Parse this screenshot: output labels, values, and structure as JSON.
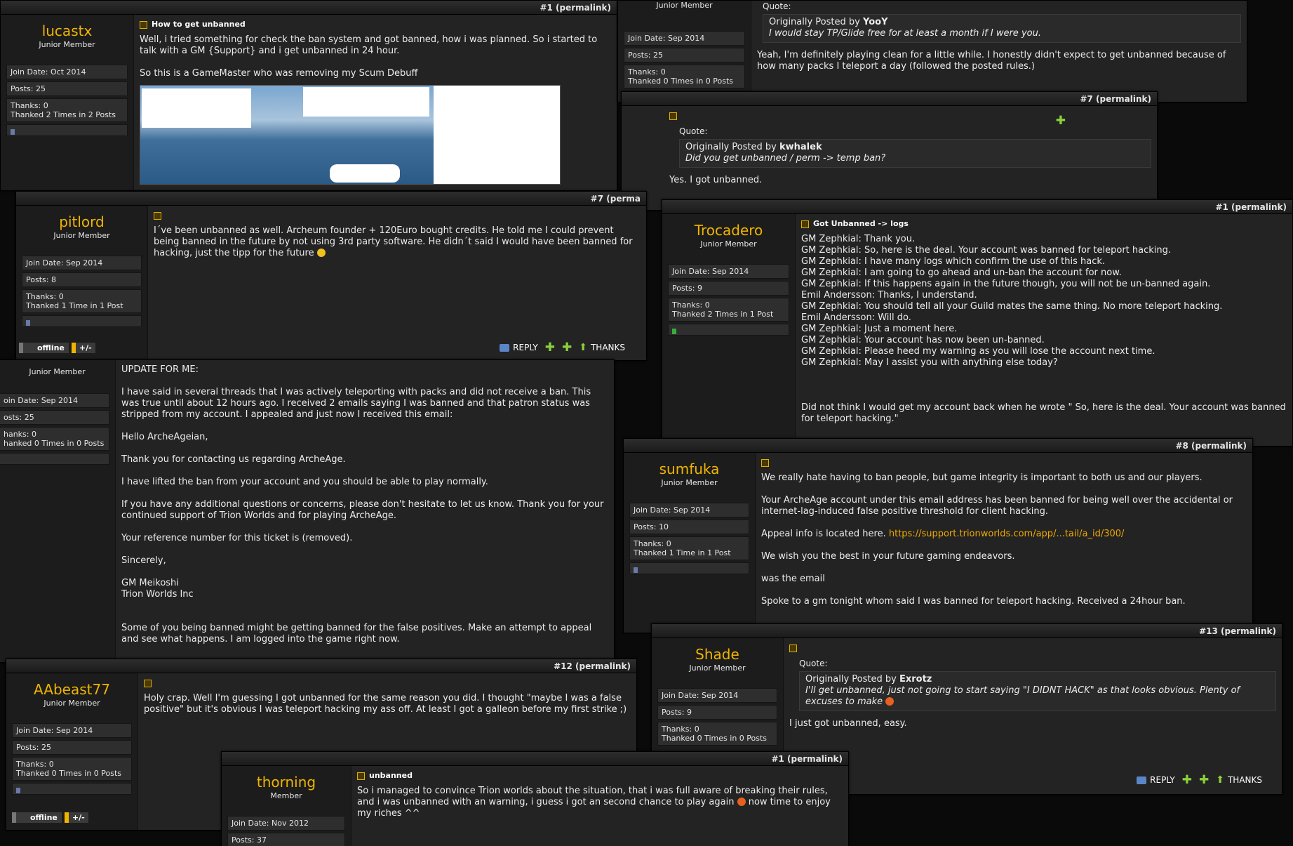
{
  "labels": {
    "join_date_prefix": "Join Date:",
    "posts_prefix": "Posts:",
    "quote": "Quote:",
    "originally_posted_by": "Originally Posted by",
    "reply": "REPLY",
    "thanks": "THANKS",
    "offline": "offline",
    "pm": "+/-"
  },
  "posts": {
    "lucastx": {
      "num": "#1 (permalink)",
      "user": "lucastx",
      "rank": "Junior Member",
      "join": "Join Date: Oct 2014",
      "posts": "Posts: 25",
      "thanks": "Thanks: 0",
      "thanked": "Thanked 2 Times in 2 Posts",
      "title": "How to get unbanned",
      "p1": "Well, i tried something for check the ban system and got banned, how i was planned. So i started to talk with a GM {Support} and i get unbanned in 24 hour.",
      "p2": "So this is a GameMaster who was removing my Scum Debuff"
    },
    "yooy": {
      "rank": "Junior Member",
      "join": "Join Date: Sep 2014",
      "posts": "Posts: 25",
      "thanks": "Thanks: 0",
      "thanked": "Thanked 0 Times in 0 Posts",
      "quote_author": "YooY",
      "quote_text": "I would stay TP/Glide free for at least a month if I were you.",
      "p1": "Yeah, I'm definitely playing clean for a little while. I honestly didn't expect to get unbanned because of how many packs I teleport a day (followed the posted rules.)"
    },
    "kwhalek": {
      "num": "#7 (permalink)",
      "quote_author": "kwhalek",
      "quote_text": "Did you get unbanned / perm -> temp ban?",
      "p1": "Yes. I got unbanned."
    },
    "pitlord": {
      "num": "#7 (perma",
      "user": "pitlord",
      "rank": "Junior Member",
      "join": "Join Date: Sep 2014",
      "posts": "Posts: 8",
      "thanks": "Thanks: 0",
      "thanked": "Thanked 1 Time in 1 Post",
      "p1": "I´ve been unbanned as well. Archeum founder + 120Euro bought credits. He told me I could prevent being banned in the future by not using 3rd party software. He didn´t said I would have been banned for hacking, just the tipp for the future"
    },
    "trocadero": {
      "num": "#1 (permalink)",
      "user": "Trocadero",
      "rank": "Junior Member",
      "join": "Join Date: Sep 2014",
      "posts": "Posts: 9",
      "thanks": "Thanks: 0",
      "thanked": "Thanked 2 Times in 1 Post",
      "title": "Got Unbanned -> logs",
      "log": "GM Zephkial: Thank you.\nGM Zephkial: So, here is the deal. Your account was banned for teleport hacking.\nGM Zephkial: I have many logs which confirm the use of this hack.\nGM Zephkial: I am going to go ahead and un-ban the account for now.\nGM Zephkial: If this happens again in the future though, you will not be un-banned again.\nEmil Andersson: Thanks, I understand.\nGM Zephkial: You should tell all your Guild mates the same thing. No more teleport hacking.\nEmil Andersson: Will do.\nGM Zephkial: Just a moment here.\nGM Zephkial: Your account has now been un-banned.\nGM Zephkial: Please heed my warning as you will lose the account next time.\nGM Zephkial: May I assist you with anything else today?",
      "p2": "Did not think I would get my account back when he wrote \" So, here is the deal. Your account was banned for teleport hacking.\""
    },
    "update": {
      "rank": "Junior Member",
      "join": "oin Date: Sep 2014",
      "posts": "osts: 25",
      "thanks": "hanks: 0",
      "thanked": "hanked 0 Times in 0 Posts",
      "text": "UPDATE FOR ME:\n\nI have said in several threads that I was actively teleporting with packs and did not receive a ban. This was true until about 12 hours ago. I received 2 emails saying I was banned and that patron status was stripped from my account. I appealed and just now I received this email:\n\nHello ArcheAgeian,\n\nThank you for contacting us regarding ArcheAge.\n\nI have lifted the ban from your account and you should be able to play normally.\n\nIf you have any additional questions or concerns, please don't hesitate to let us know. Thank you for your continued support of Trion Worlds and for playing ArcheAge.\n\nYour reference number for this ticket is (removed).\n\nSincerely,\n\nGM Meikoshi\nTrion Worlds Inc\n\n\nSome of you being banned might be getting banned for the false positives. Make an attempt to appeal and see what happens. I am logged into the game right now."
    },
    "sumfuka": {
      "num": "#8 (permalink)",
      "user": "sumfuka",
      "rank": "Junior Member",
      "join": "Join Date: Sep 2014",
      "posts": "Posts: 10",
      "thanks": "Thanks: 0",
      "thanked": "Thanked 1 Time in 1 Post",
      "p1": "We really hate having to ban people, but game integrity is important to both us and our players.",
      "p2": "Your ArcheAge account under this email address has been banned for being well over the accidental or internet-lag-induced false positive threshold for client hacking.",
      "p3_prefix": "Appeal info is located here. ",
      "p3_link": "https://support.trionworlds.com/app/...tail/a_id/300/",
      "p4": "We wish you the best in your future gaming endeavors.",
      "p5": "was the email",
      "p6": "Spoke to a gm tonight whom said I was banned for teleport hacking. Received a 24hour ban."
    },
    "shade": {
      "num": "#13 (permalink)",
      "user": "Shade",
      "rank": "Junior Member",
      "join": "Join Date: Sep 2014",
      "posts": "Posts: 9",
      "thanks": "Thanks: 0",
      "thanked": "Thanked 0 Times in 0 Posts",
      "quote_author": "Exrotz",
      "quote_text": "I'll get unbanned, just not going to start saying \"I DIDNT HACK\" as that looks obvious. Plenty of excuses to make",
      "p1": "I just got unbanned, easy."
    },
    "abeast": {
      "num": "#12 (permalink)",
      "user": "AAbeast77",
      "rank": "Junior Member",
      "join": "Join Date: Sep 2014",
      "posts": "Posts: 25",
      "thanks": "Thanks: 0",
      "thanked": "Thanked 0 Times in 0 Posts",
      "p1": "Holy crap. Well I'm guessing I got unbanned for the same reason you did. I thought \"maybe I was a false positive\" but it's obvious I was teleport hacking my ass off. At least I got a galleon before my first strike ;)"
    },
    "thorning": {
      "num": "#1 (permalink)",
      "user": "thorning",
      "rank": "Member",
      "join": "Join Date: Nov 2012",
      "posts": "Posts: 37",
      "title": "unbanned",
      "p1": "So i managed to convince Trion worlds about the situation, that i was full aware of breaking their rules, and i was unbanned with an warning, i guess i got an second chance to play again",
      "p1b": " now time to enjoy my riches ^^"
    }
  }
}
